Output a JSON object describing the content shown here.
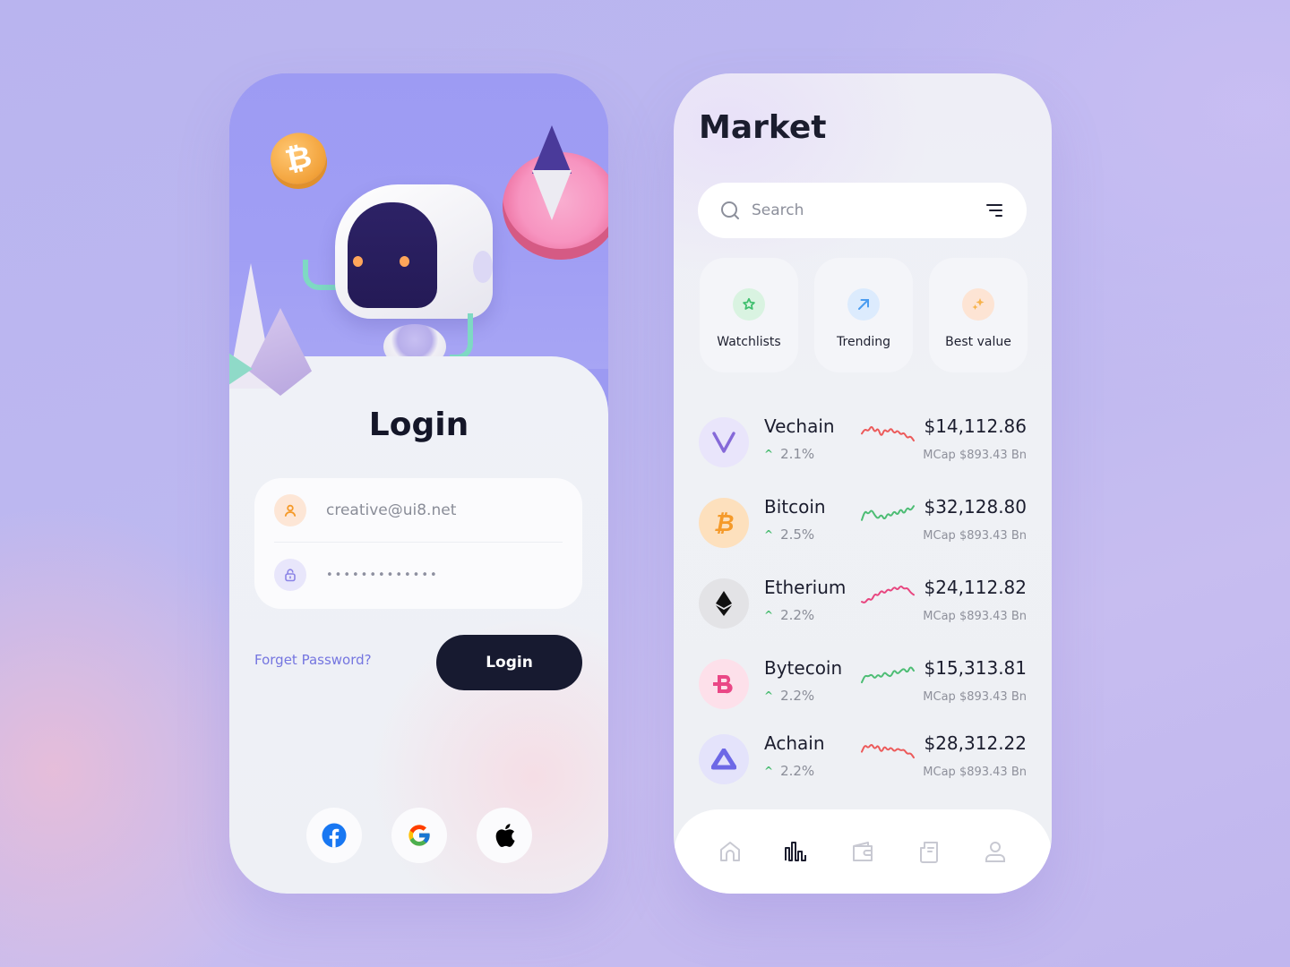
{
  "login": {
    "title": "Login",
    "email": {
      "value": "creative@ui8.net",
      "icon": "user-icon"
    },
    "password": {
      "value": "•••••••••••••",
      "icon": "lock-icon"
    },
    "forgot_password_label": "Forget Password?",
    "login_button_label": "Login",
    "hero_btc_symbol": "₿",
    "social": [
      {
        "name": "facebook",
        "icon": "facebook-icon",
        "color": "#1877f2"
      },
      {
        "name": "google",
        "icon": "google-icon"
      },
      {
        "name": "apple",
        "icon": "apple-icon",
        "color": "#000000"
      }
    ]
  },
  "market": {
    "title": "Market",
    "search": {
      "placeholder": "Search",
      "value": ""
    },
    "categories": [
      {
        "label": "Watchlists",
        "icon": "star-icon",
        "color": "#3fbf6e",
        "bg": "#d9f3e1"
      },
      {
        "label": "Trending",
        "icon": "arrow-up-right-icon",
        "color": "#4a9cf0",
        "bg": "#dcebfd"
      },
      {
        "label": "Best value",
        "icon": "sparkle-icon",
        "color": "#f7b24a",
        "bg": "#fde4d4"
      }
    ],
    "coins": [
      {
        "name": "Vechain",
        "symbol": "V",
        "change": "2.1%",
        "price": "$14,112.86",
        "mcap": "MCap $893.43 Bn",
        "trend": "down",
        "spark_color": "#ec5a5a",
        "avatar_bg": "#e9e5fb",
        "avatar_fg": "#8569d8",
        "spark": [
          0.55,
          0.35,
          0.45,
          0.2,
          0.5,
          0.3,
          0.7,
          0.35,
          0.5,
          0.3,
          0.55,
          0.4,
          0.6,
          0.5,
          0.75,
          0.65,
          0.85
        ]
      },
      {
        "name": "Bitcoin",
        "symbol": "₿",
        "change": "2.5%",
        "price": "$32,128.80",
        "mcap": "MCap $893.43 Bn",
        "trend": "up",
        "spark_color": "#4dbd74",
        "avatar_bg": "#fde0bd",
        "avatar_fg": "#f59a2a",
        "spark": [
          0.8,
          0.4,
          0.55,
          0.35,
          0.6,
          0.75,
          0.55,
          0.8,
          0.5,
          0.65,
          0.4,
          0.6,
          0.3,
          0.55,
          0.25,
          0.4,
          0.2
        ]
      },
      {
        "name": "Etherium",
        "symbol": "◆",
        "change": "2.2%",
        "price": "$24,112.82",
        "mcap": "MCap $893.43 Bn",
        "trend": "up",
        "spark_color": "#e8457f",
        "avatar_bg": "#e3e3e6",
        "avatar_fg": "#111111",
        "spark": [
          0.85,
          0.9,
          0.7,
          0.8,
          0.5,
          0.6,
          0.35,
          0.5,
          0.3,
          0.4,
          0.2,
          0.35,
          0.15,
          0.3,
          0.25,
          0.45,
          0.55
        ]
      },
      {
        "name": "Bytecoin",
        "symbol": "B",
        "change": "2.2%",
        "price": "$15,313.81",
        "mcap": "MCap $893.43 Bn",
        "trend": "up",
        "spark_color": "#4dbd74",
        "avatar_bg": "#fde0ea",
        "avatar_fg": "#ea4786",
        "spark": [
          0.85,
          0.55,
          0.6,
          0.5,
          0.7,
          0.5,
          0.65,
          0.4,
          0.55,
          0.6,
          0.3,
          0.5,
          0.35,
          0.25,
          0.45,
          0.15,
          0.35
        ]
      },
      {
        "name": "Achain",
        "symbol": "▲",
        "change": "2.2%",
        "price": "$28,312.22",
        "mcap": "MCap $893.43 Bn",
        "trend": "down",
        "spark_color": "#ec5a5a",
        "avatar_bg": "#e4e3fb",
        "avatar_fg": "#6d68e6",
        "spark": [
          0.6,
          0.3,
          0.45,
          0.25,
          0.5,
          0.3,
          0.65,
          0.35,
          0.55,
          0.4,
          0.6,
          0.45,
          0.55,
          0.5,
          0.7,
          0.65,
          0.85
        ]
      }
    ],
    "bottom_nav": [
      {
        "label": "Home",
        "icon": "home-icon",
        "active": false
      },
      {
        "label": "Market",
        "icon": "chart-bars-icon",
        "active": true
      },
      {
        "label": "Wallet",
        "icon": "wallet-icon",
        "active": false
      },
      {
        "label": "Documents",
        "icon": "document-icon",
        "active": false
      },
      {
        "label": "Profile",
        "icon": "profile-icon",
        "active": false
      }
    ]
  }
}
